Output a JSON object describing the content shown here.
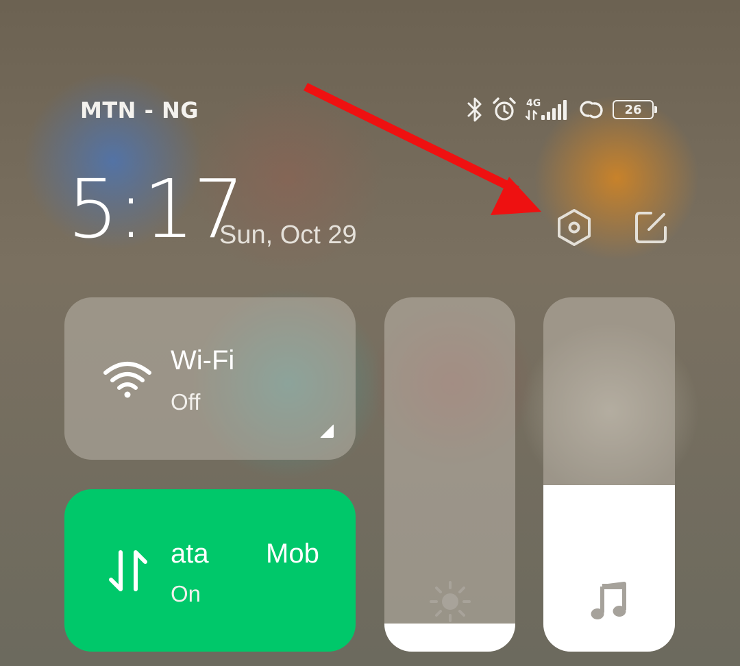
{
  "status_bar": {
    "carrier": "MTN - NG",
    "network_type": "4G",
    "battery_level": "26",
    "icons": [
      "bluetooth-icon",
      "alarm-icon",
      "signal-4g-icon",
      "hotspot-link-icon",
      "battery-icon"
    ]
  },
  "header": {
    "time": "5:17",
    "date": "Sun, Oct 29",
    "settings_icon": "settings-icon",
    "edit_icon": "edit-icon"
  },
  "tiles": {
    "wifi": {
      "title": "Wi-Fi",
      "status": "Off",
      "icon": "wifi-icon",
      "background": "#b8b2a8"
    },
    "mobile_data": {
      "title_fragment_a": "ata",
      "title_fragment_b": "Mob",
      "status": "On",
      "icon": "data-transfer-icon",
      "background": "#00c86a"
    }
  },
  "sliders": {
    "brightness": {
      "icon": "brightness-icon",
      "level_percent": 8
    },
    "volume": {
      "icon": "music-note-icon",
      "level_percent": 47
    }
  },
  "annotation": {
    "arrow_color": "#ee1111",
    "points_to": "settings-icon"
  }
}
